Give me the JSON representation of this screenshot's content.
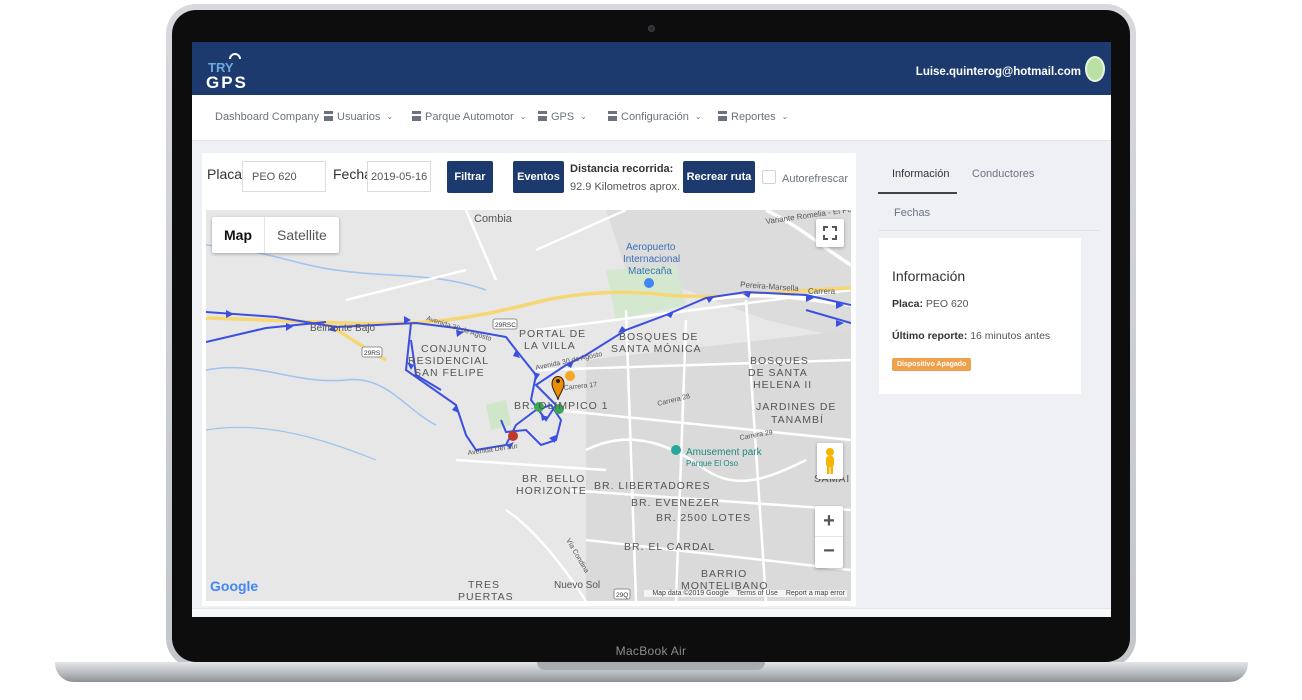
{
  "device": {
    "brand": "MacBook Air"
  },
  "header": {
    "logo_top": "TRY",
    "logo_bottom": "GPS",
    "user_email": "Luise.quinterog@hotmail.com"
  },
  "nav": {
    "items": [
      {
        "label": "Dashboard Company",
        "icon": "none",
        "dropdown": false
      },
      {
        "label": "Usuarios",
        "icon": "table-icon",
        "dropdown": true
      },
      {
        "label": "Parque Automotor",
        "icon": "table-icon",
        "dropdown": true
      },
      {
        "label": "GPS",
        "icon": "table-icon",
        "dropdown": true
      },
      {
        "label": "Configuración",
        "icon": "table-icon",
        "dropdown": true
      },
      {
        "label": "Reportes",
        "icon": "table-icon",
        "dropdown": true
      }
    ]
  },
  "filters": {
    "placa_label": "Placa:",
    "placa_value": "PEO 620",
    "fecha_label": "Fecha:",
    "fecha_value": "2019-05-16",
    "filtrar": "Filtrar",
    "eventos": "Eventos",
    "distancia_label": "Distancia recorrida:",
    "distancia_value": "92.9 Kilometros aprox.",
    "recrear": "Recrear ruta",
    "autorefrescar": "Autorefrescar",
    "autorefrescar_checked": false
  },
  "map": {
    "type_map": "Map",
    "type_satellite": "Satellite",
    "zoom_in": "+",
    "zoom_out": "−",
    "google": "Google",
    "attribution": {
      "data": "Map data ©2019 Google",
      "terms": "Terms of Use",
      "report": "Report a map error"
    },
    "labels": {
      "combia": "Combia",
      "aeropuerto1": "Aeropuerto",
      "aeropuerto2": "Internacional",
      "aeropuerto3": "Matecaña",
      "variante": "Variante Romelia - El Pollo",
      "pereira": "Pereira-Marsella",
      "carrera_r": "Carrera",
      "belmonte": "Belmonte Bajo",
      "avenida30a": "Avenida 30 de Agosto",
      "avenida30b": "Avenida 30 de Agosto",
      "r29a": "29RSC",
      "r29b": "29RS",
      "portal1": "PORTAL DE",
      "portal2": "LA VILLA",
      "bosquessm1": "BOSQUES DE",
      "bosquessm2": "SANTA MÓNICA",
      "conjunto1": "CONJUNTO",
      "conjunto2": "RESIDENCIAL",
      "conjunto3": "SAN FELIPE",
      "bosquessh1": "BOSQUES",
      "bosquessh2": "DE SANTA",
      "bosquessh3": "HELENA II",
      "carrera17": "Carrera 17",
      "carrera28": "Carrera 28",
      "br_olimpico": "BR. OLIMPICO 1",
      "jardines1": "JARDINES DE",
      "jardines2": "TANAMBÍ",
      "carrera29": "Carrera 29",
      "amusement": "Amusement park",
      "parque": "Parque El Oso",
      "avenida_sur": "Avenida Del Sur",
      "bello1": "BR. BELLO",
      "bello2": "HORIZONTE",
      "libertadores": "BR. LIBERTADORES",
      "evenezer": "BR. EVENEZER",
      "lotes": "BR. 2500 LOTES",
      "cardal": "BR. EL CARDAL",
      "via": "Vía Condina",
      "barrio1": "BARRIO",
      "barrio2": "MONTELIBANO",
      "tres1": "TRES",
      "tres2": "PUERTAS",
      "nuevo": "Nuevo Sol",
      "r29q": "29Q",
      "samai": "SAMAI"
    },
    "colors": {
      "route": "#3b4fe0",
      "road_major": "#f7d675",
      "water": "#9fc4f0",
      "marker_orange": "#f5a623",
      "marker_green": "#3aa757",
      "marker_red": "#c0392b"
    }
  },
  "side": {
    "tabs": [
      "Información",
      "Conductores",
      "Fechas"
    ],
    "info_title": "Información",
    "placa_label": "Placa:",
    "placa_value": "PEO 620",
    "reporte_label": "Último reporte:",
    "reporte_value": "16 minutos antes",
    "status": "Dispositivo Apagado"
  }
}
